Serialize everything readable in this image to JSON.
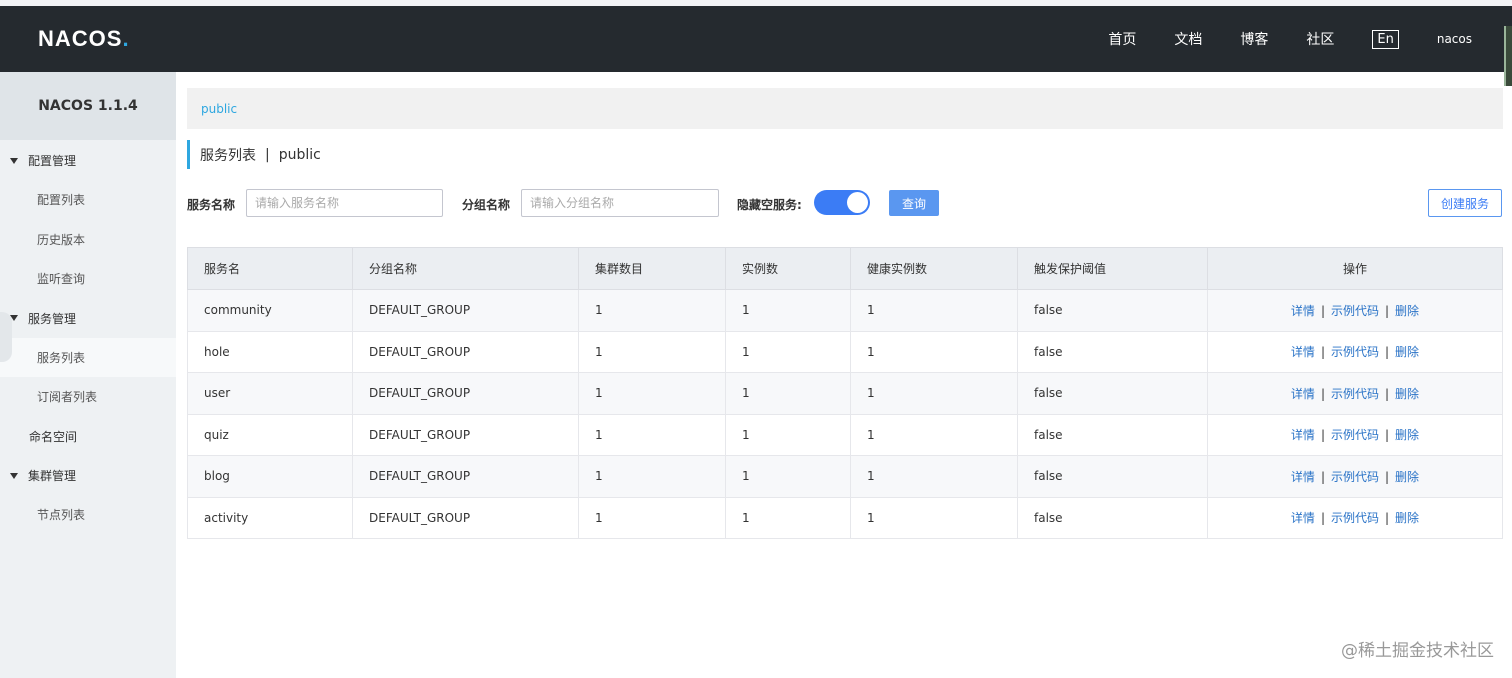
{
  "header": {
    "logo_main": "NACOS",
    "logo_dot": ".",
    "nav": [
      "首页",
      "文档",
      "博客",
      "社区"
    ],
    "lang": "En",
    "user": "nacos",
    "bg_color": "#252a2f"
  },
  "sidebar": {
    "title": "NACOS 1.1.4",
    "groups": [
      {
        "label": "配置管理",
        "items": [
          "配置列表",
          "历史版本",
          "监听查询"
        ]
      },
      {
        "label": "服务管理",
        "items": [
          "服务列表",
          "订阅者列表"
        ]
      }
    ],
    "namespace": "命名空间",
    "cluster": {
      "label": "集群管理",
      "items": [
        "节点列表"
      ]
    },
    "active_item": "服务列表"
  },
  "breadcrumb": "public",
  "page": {
    "title": "服务列表",
    "sep": "|",
    "namespace": "public"
  },
  "filters": {
    "service_label": "服务名称",
    "service_placeholder": "请输入服务名称",
    "group_label": "分组名称",
    "group_placeholder": "请输入分组名称",
    "hide_empty_label": "隐藏空服务:",
    "hide_empty_on": true,
    "query_label": "查询",
    "create_label": "创建服务"
  },
  "table": {
    "headers": [
      "服务名",
      "分组名称",
      "集群数目",
      "实例数",
      "健康实例数",
      "触发保护阈值",
      "操作"
    ],
    "ops": {
      "detail": "详情",
      "sample": "示例代码",
      "delete": "删除",
      "sep": "|"
    },
    "rows": [
      {
        "name": "community",
        "group": "DEFAULT_GROUP",
        "clusters": "1",
        "instances": "1",
        "healthy": "1",
        "threshold": "false"
      },
      {
        "name": "hole",
        "group": "DEFAULT_GROUP",
        "clusters": "1",
        "instances": "1",
        "healthy": "1",
        "threshold": "false"
      },
      {
        "name": "user",
        "group": "DEFAULT_GROUP",
        "clusters": "1",
        "instances": "1",
        "healthy": "1",
        "threshold": "false"
      },
      {
        "name": "quiz",
        "group": "DEFAULT_GROUP",
        "clusters": "1",
        "instances": "1",
        "healthy": "1",
        "threshold": "false"
      },
      {
        "name": "blog",
        "group": "DEFAULT_GROUP",
        "clusters": "1",
        "instances": "1",
        "healthy": "1",
        "threshold": "false"
      },
      {
        "name": "activity",
        "group": "DEFAULT_GROUP",
        "clusters": "1",
        "instances": "1",
        "healthy": "1",
        "threshold": "false"
      }
    ]
  },
  "watermark": "@稀土掘金技术社区",
  "accent_color": "#2ea7e0",
  "primary_color": "#3b7cf5"
}
